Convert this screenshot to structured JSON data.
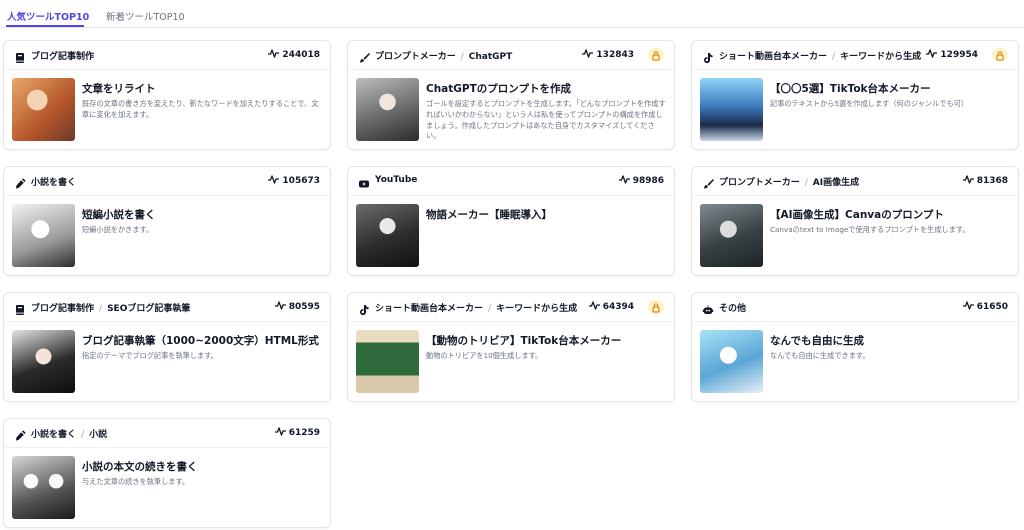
{
  "tabs": [
    {
      "label": "人気ツールTOP10",
      "active": true
    },
    {
      "label": "新着ツールTOP10",
      "active": false
    }
  ],
  "colors": {
    "accent": "#4f46e5",
    "lock_bg": "#fef3c7",
    "lock_icon": "#d97706"
  },
  "cards": [
    {
      "category": "ブログ記事制作",
      "subcategory": "",
      "icon": "book-icon",
      "count": "244018",
      "locked": false,
      "title": "文章をリライト",
      "description": "既存の文章の書き方を変えたり、新たなワードを加えたりすることで、文章に変化を加えます。"
    },
    {
      "category": "プロンプトメーカー",
      "subcategory": "ChatGPT",
      "icon": "brush-icon",
      "count": "132843",
      "locked": true,
      "title": "ChatGPTのプロンプトを作成",
      "description": "ゴールを設定するとプロンプトを生成します。「どんなプロンプトを作成すればいいかわからない」という人は私を使ってプロンプトの構成を作成しましょう。作成したプロンプトはあなた自身でカスタマイズしてください。"
    },
    {
      "category": "ショート動画台本メーカー",
      "subcategory": "キーワードから生成",
      "icon": "tiktok-icon",
      "count": "129954",
      "locked": true,
      "title": "【〇〇5選】TikTok台本メーカー",
      "description": "記事のテキストから5選を作成します（何のジャンルでも可）"
    },
    {
      "category": "小説を書く",
      "subcategory": "",
      "icon": "pen-icon",
      "count": "105673",
      "locked": false,
      "title": "短編小説を書く",
      "description": "短編小説をかきます。"
    },
    {
      "category": "YouTube",
      "subcategory": "",
      "icon": "youtube-icon",
      "count": "98986",
      "locked": false,
      "title": "物語メーカー【睡眠導入】",
      "description": ""
    },
    {
      "category": "プロンプトメーカー",
      "subcategory": "AI画像生成",
      "icon": "brush-icon",
      "count": "81368",
      "locked": false,
      "title": "【AI画像生成】Canvaのプロンプト",
      "description": "Canvaのtext to Imageで使用するプロンプトを生成します。"
    },
    {
      "category": "ブログ記事制作",
      "subcategory": "SEOブログ記事執筆",
      "icon": "book-icon",
      "count": "80595",
      "locked": false,
      "title": "ブログ記事執筆（1000~2000文字）HTML形式",
      "description": "指定のテーマでブログ記事を執筆します。"
    },
    {
      "category": "ショート動画台本メーカー",
      "subcategory": "キーワードから生成",
      "icon": "tiktok-icon",
      "count": "64394",
      "locked": true,
      "title": "【動物のトリビア】TikTok台本メーカー",
      "description": "動物のトリビアを10個生成します。"
    },
    {
      "category": "その他",
      "subcategory": "",
      "icon": "robot-icon",
      "count": "61650",
      "locked": false,
      "title": "なんでも自由に生成",
      "description": "なんでも自由に生成できます。"
    },
    {
      "category": "小説を書く",
      "subcategory": "小説",
      "icon": "pen-icon",
      "count": "61259",
      "locked": false,
      "title": "小説の本文の続きを書く",
      "description": "与えた文章の続きを執筆します。"
    }
  ]
}
